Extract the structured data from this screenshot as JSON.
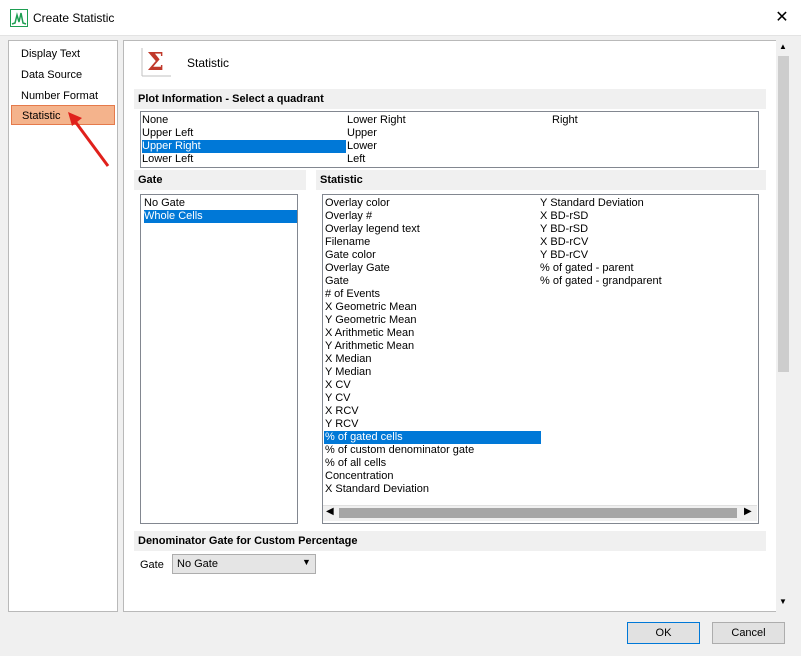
{
  "window": {
    "title": "Create Statistic",
    "close_glyph": "✕"
  },
  "nav": {
    "items": [
      "Display Text",
      "Data Source",
      "Number Format",
      "Statistic"
    ],
    "selected": "Statistic"
  },
  "header": {
    "title": "Statistic",
    "icon": "sigma-icon",
    "sigma_glyph": "Σ"
  },
  "plot_information": {
    "heading": "Plot Information - Select a quadrant",
    "columns": [
      [
        "None",
        "Upper Left",
        "Upper Right",
        "Lower Left"
      ],
      [
        "Lower Right",
        "Upper",
        "Lower",
        "Left"
      ],
      [
        "Right"
      ]
    ],
    "selected": "Upper Right"
  },
  "gate": {
    "heading": "Gate",
    "items": [
      "No Gate",
      "Whole Cells"
    ],
    "selected": "Whole Cells"
  },
  "statistic": {
    "heading": "Statistic",
    "column1": [
      "Overlay color",
      "Overlay #",
      "Overlay legend text",
      "Filename",
      "Gate color",
      "Overlay Gate",
      "Gate",
      "# of Events",
      "X Geometric Mean",
      "Y Geometric Mean",
      "X Arithmetic Mean",
      "Y Arithmetic Mean",
      "X Median",
      "Y Median",
      "X CV",
      "Y CV",
      "X RCV",
      "Y RCV",
      "% of gated cells",
      "% of custom denominator gate",
      "% of all cells",
      "Concentration",
      "X Standard Deviation"
    ],
    "column2": [
      "Y Standard Deviation",
      "X BD-rSD",
      "Y BD-rSD",
      "X BD-rCV",
      "Y BD-rCV",
      "% of gated - parent",
      "% of gated - grandparent"
    ],
    "selected": "% of gated cells"
  },
  "denominator": {
    "heading": "Denominator Gate for Custom Percentage",
    "gate_label": "Gate",
    "gate_value": "No Gate"
  },
  "buttons": {
    "ok": "OK",
    "cancel": "Cancel"
  },
  "colors": {
    "selection": "#0078d7",
    "nav_selected": "#f4b38c",
    "arrow": "#e0201b",
    "sigma": "#c0392b"
  }
}
